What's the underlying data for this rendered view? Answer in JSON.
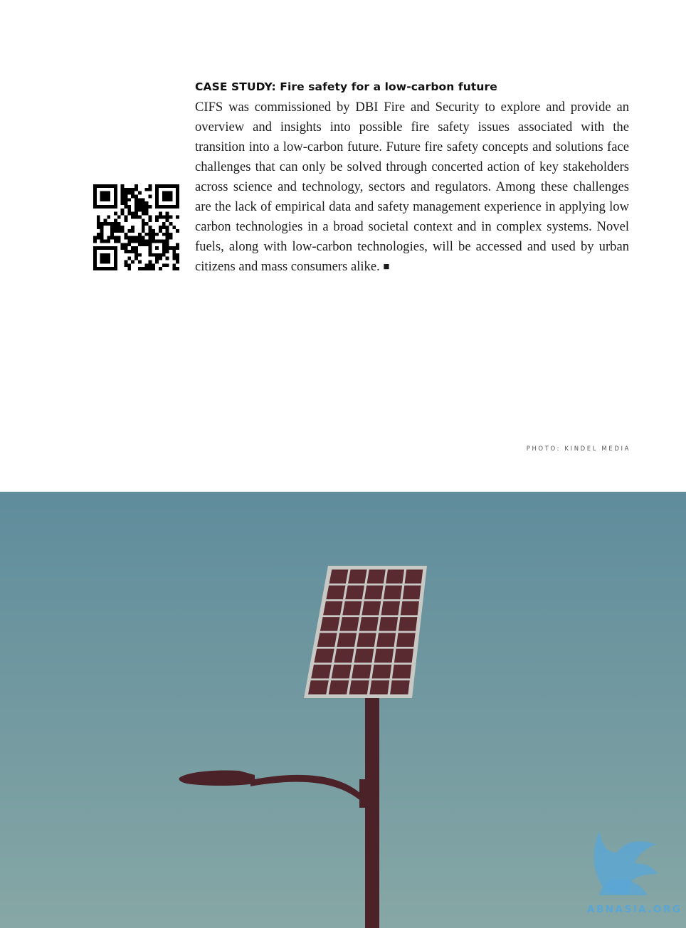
{
  "case_study": {
    "heading": "CASE STUDY: Fire safety for a low-carbon future",
    "body": "CIFS was commissioned by DBI Fire and Security to explore and provide an overview and insights into possible fire safety issues associated with the transition into a low-carbon future. Future fire safety concepts and solutions face challenges that can only be solved through concerted action of key stakeholders across science and technology, sectors and regulators. Among these challenges are the lack of empirical data and safety management experience in applying low carbon technologies in a broad societal context and in complex systems. Novel fuels, along with low-carbon technologies, will be accessed and used by urban citizens and mass consumers alike.",
    "end_mark": "■"
  },
  "qr": {
    "icon": "qr-code"
  },
  "photo": {
    "credit": "PHOTO: KINDEL MEDIA",
    "sky_top_color": "#5f8c9c",
    "sky_bottom_color": "#86a7a5",
    "pole_color": "#4a2228",
    "panel_cell_color": "#5a2a31",
    "panel_frame_color": "#c8c8c4"
  },
  "watermark": {
    "text": "ABNASIA.ORG",
    "color": "#5aa6d6",
    "icon": "griffin-logo"
  }
}
